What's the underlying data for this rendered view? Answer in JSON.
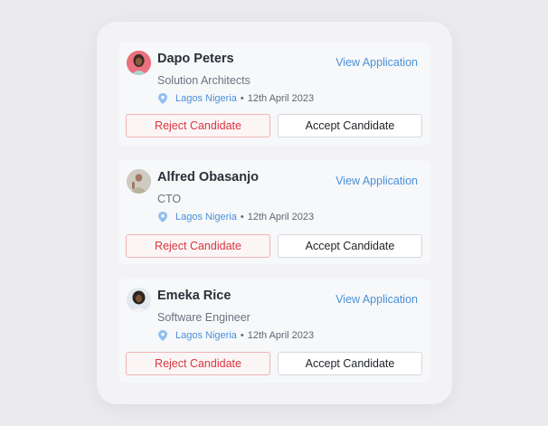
{
  "candidates": [
    {
      "name": "Dapo Peters",
      "role": "Solution Architects",
      "location": "Lagos Nigeria",
      "separator": "•",
      "date": "12th April 2023",
      "view_label": "View Application",
      "reject_label": "Reject Candidate",
      "accept_label": "Accept Candidate",
      "avatar_bg": "#e86a78"
    },
    {
      "name": "Alfred Obasanjo",
      "role": "CTO",
      "location": "Lagos Nigeria",
      "separator": "•",
      "date": "12th April 2023",
      "view_label": "View Application",
      "reject_label": "Reject Candidate",
      "accept_label": "Accept Candidate",
      "avatar_bg": "#c9c5bd"
    },
    {
      "name": "Emeka Rice",
      "role": "Software Engineer",
      "location": "Lagos Nigeria",
      "separator": "•",
      "date": "12th April 2023",
      "view_label": "View Application",
      "reject_label": "Reject Candidate",
      "accept_label": "Accept Candidate",
      "avatar_bg": "#dfe6ee"
    }
  ],
  "colors": {
    "link": "#4a90d9",
    "reject": "#d9363e",
    "reject_border": "#f0b4b4"
  },
  "icons": {
    "location": "location-pin-icon"
  }
}
